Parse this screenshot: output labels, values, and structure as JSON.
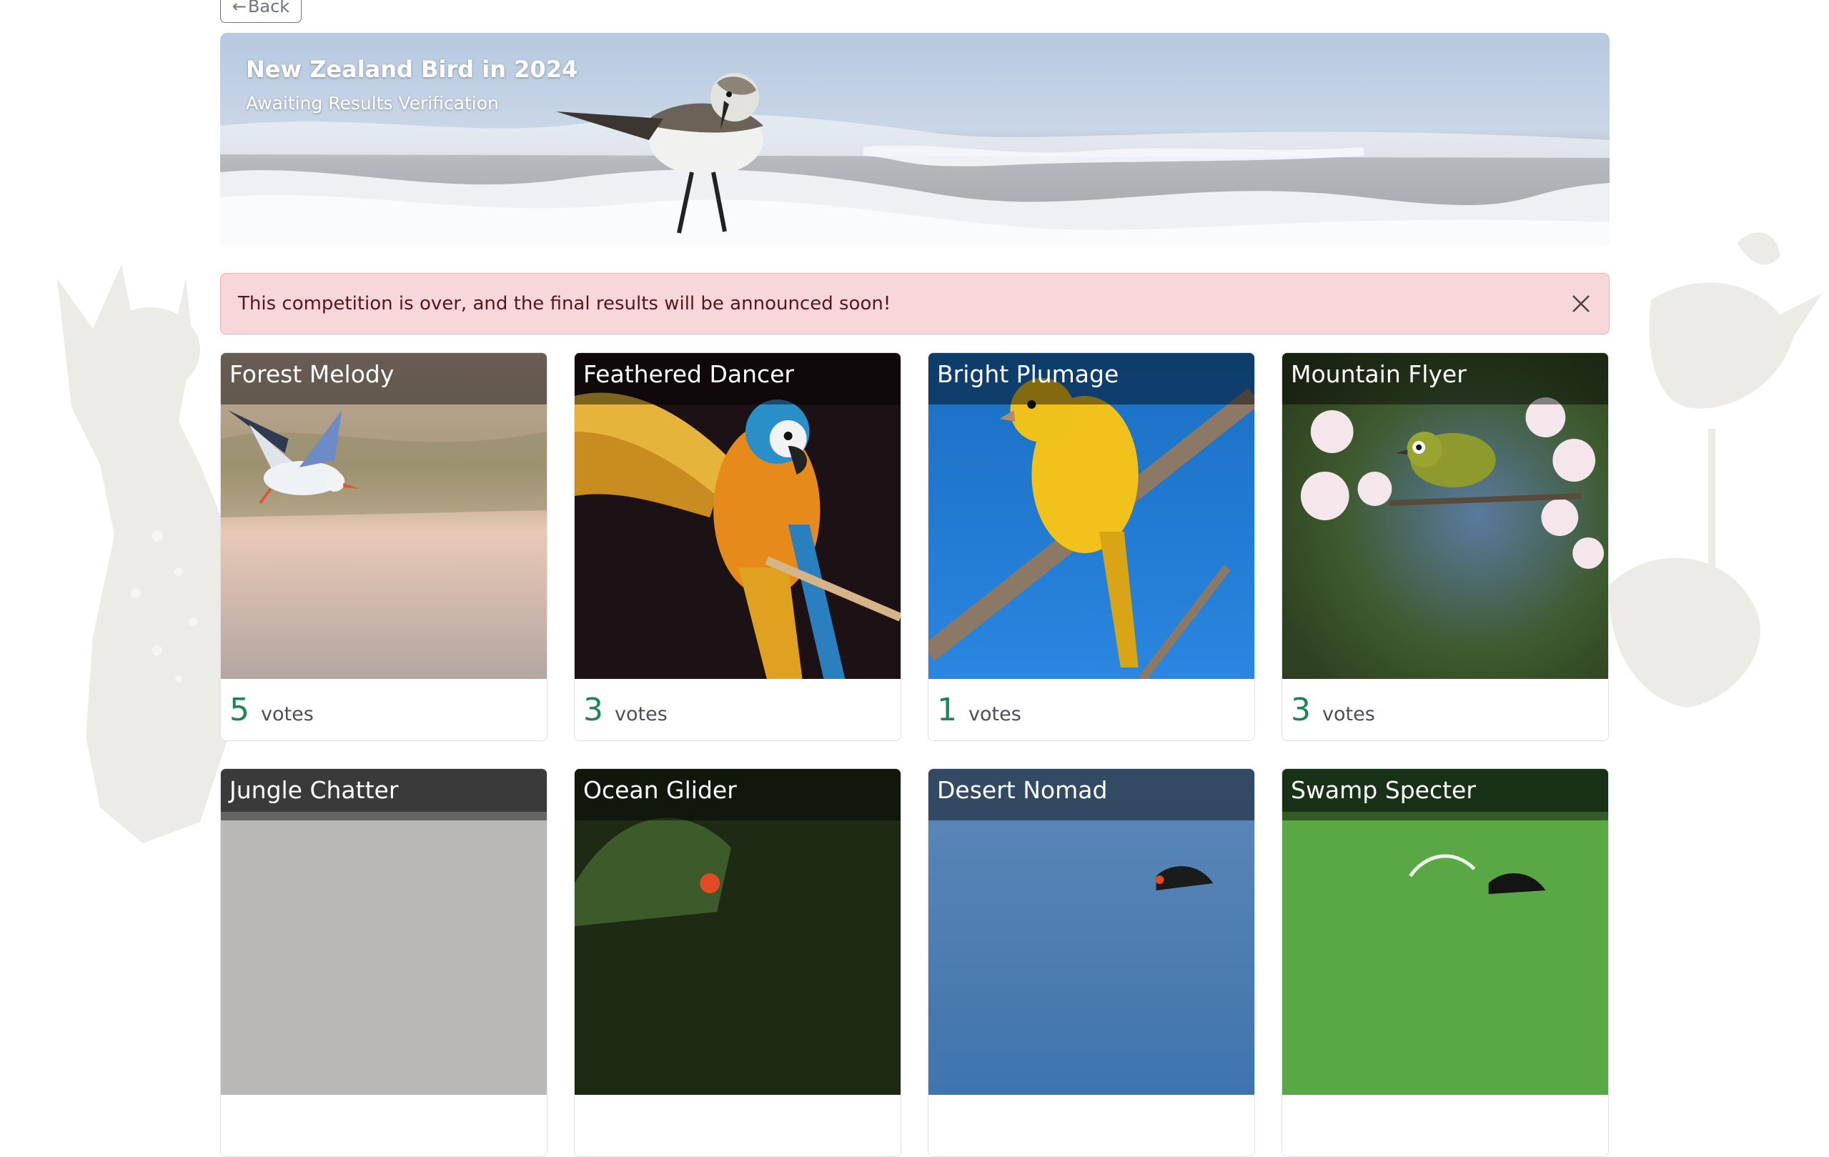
{
  "back": {
    "arrow": "←",
    "label": "Back"
  },
  "hero": {
    "title": "New Zealand Bird in 2024",
    "subtitle": "Awaiting Results Verification"
  },
  "alert": {
    "message": "This competition is over, and the final results will be announced soon!",
    "close_icon": "close-icon"
  },
  "colors": {
    "alert_bg": "#f8d7da",
    "alert_text": "#58151c",
    "votes_green": "#198754"
  },
  "cards": [
    {
      "name": "Forest Melody",
      "votes": "5",
      "votes_label": "votes"
    },
    {
      "name": "Feathered Dancer",
      "votes": "3",
      "votes_label": "votes"
    },
    {
      "name": "Bright Plumage",
      "votes": "1",
      "votes_label": "votes"
    },
    {
      "name": "Mountain Flyer",
      "votes": "3",
      "votes_label": "votes"
    },
    {
      "name": "Jungle Chatter",
      "votes": "",
      "votes_label": ""
    },
    {
      "name": "Ocean Glider",
      "votes": "",
      "votes_label": ""
    },
    {
      "name": "Desert Nomad",
      "votes": "",
      "votes_label": ""
    },
    {
      "name": "Swamp Specter",
      "votes": "",
      "votes_label": ""
    }
  ]
}
